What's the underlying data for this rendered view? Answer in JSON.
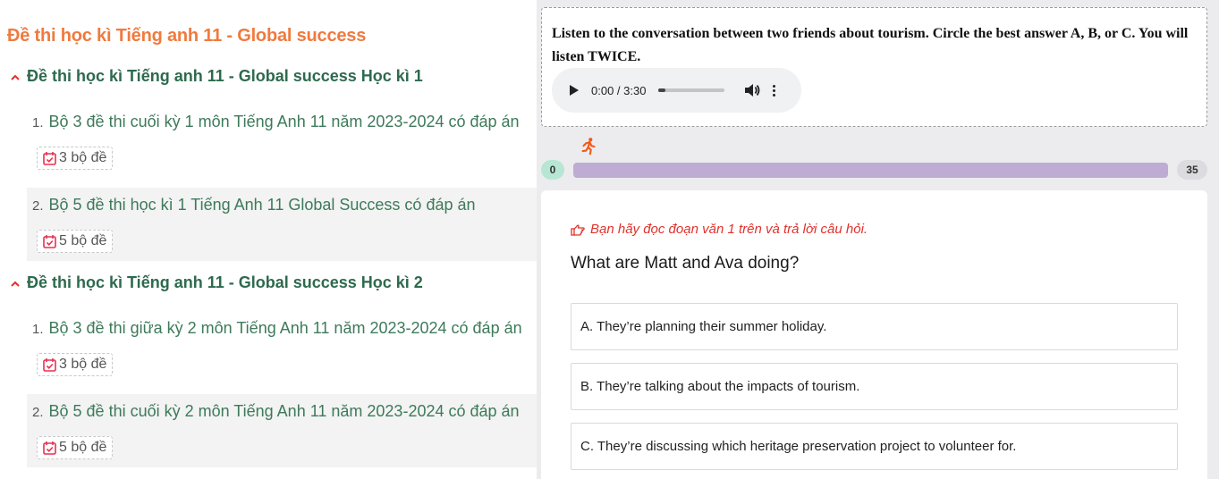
{
  "page_title": "Đề thi học kì Tiếng anh 11 - Global success",
  "sections": [
    {
      "heading": "Đề thi học kì Tiếng anh 11 - Global success Học kì 1",
      "items": [
        {
          "num": "1.",
          "title": "Bộ 3 đề thi cuối kỳ 1 môn Tiếng Anh 11 năm 2023-2024 có đáp án",
          "badge": "3 bộ đề"
        },
        {
          "num": "2.",
          "title": "Bộ 5 đề thi học kì 1 Tiếng Anh 11 Global Success có đáp án",
          "badge": "5 bộ đề"
        }
      ]
    },
    {
      "heading": "Đề thi học kì Tiếng anh 11 - Global success Học kì 2",
      "items": [
        {
          "num": "1.",
          "title": "Bộ 3 đề thi giữa kỳ 2 môn Tiếng Anh 11 năm 2023-2024 có đáp án",
          "badge": "3 bộ đề"
        },
        {
          "num": "2.",
          "title": "Bộ 5 đề thi cuối kỳ 2 môn Tiếng Anh 11 năm 2023-2024 có đáp án",
          "badge": "5 bộ đề"
        }
      ]
    }
  ],
  "listening": {
    "instruction": "Listen to the conversation between two friends about tourism. Circle the best answer A, B, or C. You will listen TWICE.",
    "audio_time": "0:00 / 3:30",
    "audio_progress": 0
  },
  "progress": {
    "start": "0",
    "end": "35",
    "bar_color": "#bfacd3"
  },
  "quiz": {
    "hint": "Bạn hãy đọc đoạn văn 1 trên và trả lời câu hỏi.",
    "question": "What are Matt and Ava doing?",
    "options": [
      "A. They’re planning their summer holiday.",
      "B. They’re talking about the impacts of tourism.",
      "C. They’re discussing which heritage preservation project to volunteer for."
    ]
  },
  "colors": {
    "title_orange": "#f07a3e",
    "heading_green": "#2e6a4e",
    "accent_red": "#e0312b",
    "badge_icon": "#e8304f"
  }
}
